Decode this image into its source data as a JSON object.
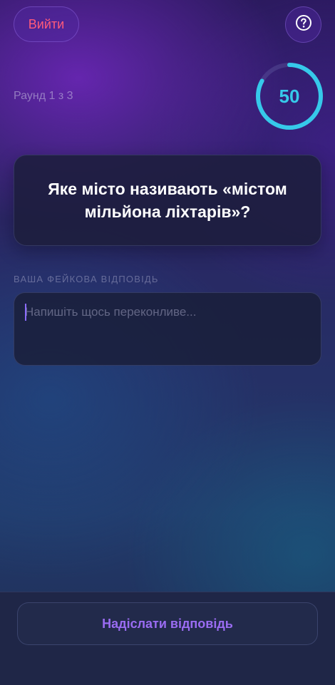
{
  "header": {
    "exit_label": "Вийти",
    "help_icon": "question-circle-icon"
  },
  "round": {
    "label": "Раунд 1 з 3"
  },
  "timer": {
    "value": "50",
    "progress": 0.83,
    "color": "#36c9ea"
  },
  "question": {
    "text": "Яке місто називають «містом мільйона ліхтарів»?"
  },
  "answer": {
    "label": "ВАША ФЕЙКОВА ВІДПОВІДЬ",
    "placeholder": "Напишіть щось переконливе...",
    "value": ""
  },
  "footer": {
    "submit_label": "Надіслати відповідь"
  },
  "colors": {
    "accent": "#9a6cf2",
    "danger": "#ff5a7a",
    "timer": "#36c9ea"
  }
}
